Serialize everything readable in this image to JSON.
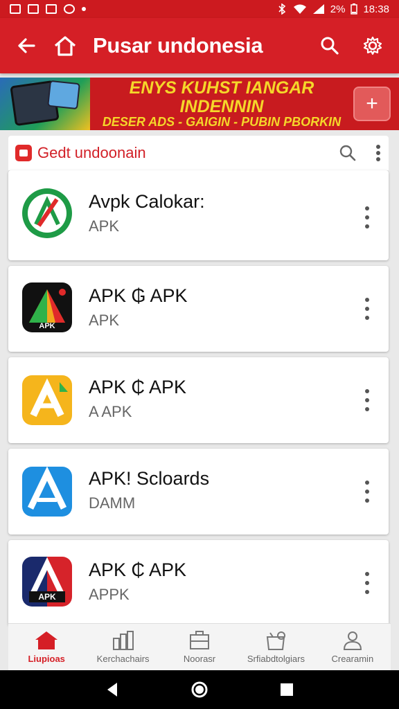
{
  "status_bar": {
    "battery": "2%",
    "time": "18:38"
  },
  "app_bar": {
    "title": "Pusar undonesia"
  },
  "banner": {
    "line1": "ENYS KUHST IANGAR INDENNIN",
    "line2": "DESER ADS - GAIGIN - PUBIN PBORKIN",
    "cta": "+"
  },
  "list": {
    "header_title": "Gedt undoonain",
    "items": [
      {
        "name": "Avpk Calokar:",
        "subtitle": "APK",
        "icon": "green-circle-a-icon",
        "icon_text": ""
      },
      {
        "name": "APK ₲ APK",
        "subtitle": "APK",
        "icon": "black-triangle-a-icon",
        "icon_text": "APK"
      },
      {
        "name": "APK ₵ APK",
        "subtitle": "A APK",
        "icon": "yellow-a-icon",
        "icon_text": ""
      },
      {
        "name": "APK! Scloards",
        "subtitle": "DAMM",
        "icon": "blue-a-icon",
        "icon_text": ""
      },
      {
        "name": "APK ₵ APK",
        "subtitle": "APPK",
        "icon": "red-blue-a-icon",
        "icon_text": "APK"
      }
    ]
  },
  "bottom_nav": {
    "items": [
      {
        "label": "Liupioas",
        "icon": "home-icon",
        "active": true
      },
      {
        "label": "Kerchachairs",
        "icon": "chart-icon",
        "active": false
      },
      {
        "label": "Noorasr",
        "icon": "briefcase-icon",
        "active": false
      },
      {
        "label": "Srfiabdtolgiars",
        "icon": "gift-icon",
        "active": false
      },
      {
        "label": "Crearamin",
        "icon": "person-icon",
        "active": false
      }
    ]
  },
  "colors": {
    "brand_red": "#d51f26",
    "banner_yellow": "#f5d72a"
  }
}
